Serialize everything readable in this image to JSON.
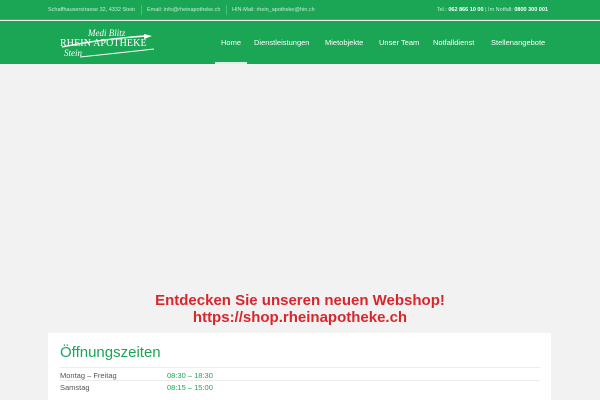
{
  "topbar": {
    "address": "Schaffhauserstrasse 32, 4332 Stein",
    "email": "Email: info@rheinapotheke.ch",
    "hin_mail": "HIN-Mail: rhein_apotheke@hin.ch",
    "tel_label": "Tel.:",
    "tel_number": "062 866 10 00",
    "separator": "|",
    "emergency_label": "Im Notfall:",
    "emergency_number": "0800 300 001"
  },
  "logo": {
    "line1": "Medi Blitz",
    "line2": "RHEIN APOTHEKE",
    "line3": "Stein"
  },
  "nav": {
    "items": [
      {
        "label": "Home",
        "active": true
      },
      {
        "label": "Dienstleistungen",
        "active": false
      },
      {
        "label": "Mietobjekte",
        "active": false
      },
      {
        "label": "Unser Team",
        "active": false
      },
      {
        "label": "Notfalldienst",
        "active": false
      },
      {
        "label": "Stellenangebote",
        "active": false
      }
    ]
  },
  "webshop": {
    "line1": "Entdecken Sie unseren neuen Webshop!",
    "line2": "https://shop.rheinapotheke.ch"
  },
  "hours": {
    "title": "Öffnungszeiten",
    "rows": [
      {
        "day": "Montag – Freitag",
        "time": "08:30 – 18:30"
      },
      {
        "day": "Samstag",
        "time": "08:15 – 15:00"
      }
    ]
  },
  "colors": {
    "brand_green": "#1aa655",
    "promo_red": "#d9262c",
    "background": "#f2f2f2"
  }
}
